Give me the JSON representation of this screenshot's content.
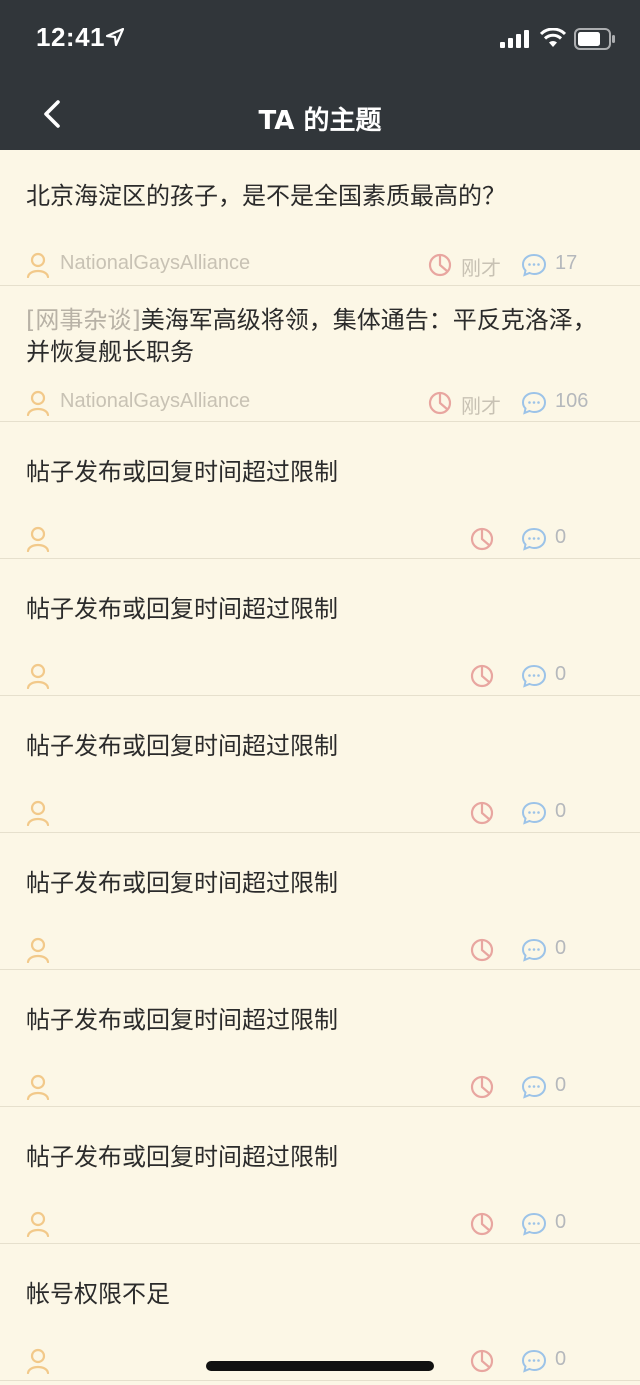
{
  "status_bar": {
    "time": "12:41"
  },
  "nav": {
    "title": "TA 的主题"
  },
  "posts": [
    {
      "tag": "",
      "title": "北京海淀区的孩子，是不是全国素质最高的？",
      "author": "NationalGaysAlliance",
      "time": "刚才",
      "comments": "17"
    },
    {
      "tag": "[网事杂谈]",
      "title": "美海军高级将领，集体通告：平反克洛泽，并恢复舰长职务",
      "author": "NationalGaysAlliance",
      "time": "刚才",
      "comments": "106"
    },
    {
      "tag": "",
      "title": "帖子发布或回复时间超过限制",
      "author": "",
      "time": "",
      "comments": "0"
    },
    {
      "tag": "",
      "title": "帖子发布或回复时间超过限制",
      "author": "",
      "time": "",
      "comments": "0"
    },
    {
      "tag": "",
      "title": "帖子发布或回复时间超过限制",
      "author": "",
      "time": "",
      "comments": "0"
    },
    {
      "tag": "",
      "title": "帖子发布或回复时间超过限制",
      "author": "",
      "time": "",
      "comments": "0"
    },
    {
      "tag": "",
      "title": "帖子发布或回复时间超过限制",
      "author": "",
      "time": "",
      "comments": "0"
    },
    {
      "tag": "",
      "title": "帖子发布或回复时间超过限制",
      "author": "",
      "time": "",
      "comments": "0"
    },
    {
      "tag": "",
      "title": "帐号权限不足",
      "author": "",
      "time": "",
      "comments": "0"
    }
  ],
  "colors": {
    "header_bg": "#31363A",
    "page_bg": "#FCF7E6",
    "user_icon": "#F2C98A",
    "time_icon": "#E8A6A0",
    "comment_icon": "#9CC3E8"
  },
  "icons": [
    "location-arrow-icon",
    "signal-icon",
    "wifi-icon",
    "battery-icon",
    "back-chevron-icon",
    "user-icon",
    "clock-icon",
    "comment-icon"
  ]
}
